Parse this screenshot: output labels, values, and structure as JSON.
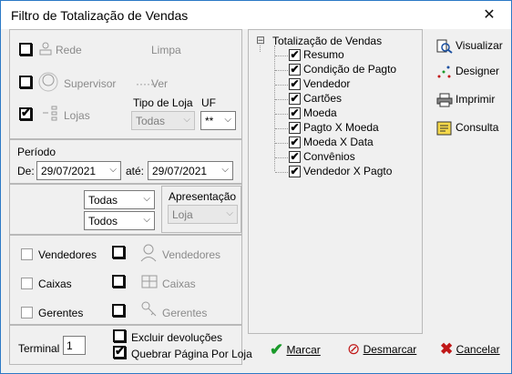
{
  "window": {
    "title": "Filtro de Totalização de Vendas",
    "close_glyph": "✕"
  },
  "left": {
    "rede": {
      "label": "Rede",
      "checked": false
    },
    "limpa": "Limpa",
    "supervisor": {
      "label": "Supervisor",
      "checked": false
    },
    "ver": "Ver",
    "lojas": {
      "label": "Lojas",
      "checked": true
    },
    "tipo_loja_label": "Tipo de Loja",
    "tipo_loja_value": "Todas",
    "uf_label": "UF",
    "uf_value": "**",
    "periodo_label": "Período",
    "de_label": "De:",
    "de_value": "29/07/2021",
    "ate_label": "até:",
    "ate_value": "29/07/2021",
    "select_a_value": "Todas",
    "select_b_value": "Todos",
    "apresentacao_label": "Apresentação",
    "apresentacao_value": "Loja",
    "check_left": [
      {
        "label": "Vendedores",
        "checked": false
      },
      {
        "label": "Caixas",
        "checked": false
      },
      {
        "label": "Gerentes",
        "checked": false
      }
    ],
    "check_right": [
      {
        "label": "Vendedores",
        "checked": false
      },
      {
        "label": "Caixas",
        "checked": false
      },
      {
        "label": "Gerentes",
        "checked": false
      }
    ],
    "terminal_label": "Terminal",
    "terminal_value": "1",
    "excluir_devolucoes": {
      "label": "Excluir devoluções",
      "checked": false
    },
    "quebrar_pagina": {
      "label": "Quebrar Página Por Loja",
      "checked": true
    }
  },
  "tree": {
    "root": "Totalização de Vendas",
    "expander": "⊟",
    "items": [
      {
        "label": "Resumo",
        "checked": true
      },
      {
        "label": "Condição de Pagto",
        "checked": true
      },
      {
        "label": "Vendedor",
        "checked": true
      },
      {
        "label": "Cartões",
        "checked": true
      },
      {
        "label": "Moeda",
        "checked": true
      },
      {
        "label": "Pagto X Moeda",
        "checked": true
      },
      {
        "label": "Moeda X Data",
        "checked": true
      },
      {
        "label": "Convênios",
        "checked": true
      },
      {
        "label": "Vendedor X Pagto",
        "checked": true
      }
    ]
  },
  "right_buttons": [
    {
      "label": "Visualizar",
      "icon": "magnifier-icon"
    },
    {
      "label": "Designer",
      "icon": "designer-icon"
    },
    {
      "label": "Imprimir",
      "icon": "printer-icon"
    },
    {
      "label": "Consulta",
      "icon": "query-icon"
    }
  ],
  "bottom_buttons": {
    "marcar": "Marcar",
    "desmarcar": "Desmarcar",
    "cancelar": "Cancelar"
  },
  "colors": {
    "window_border": "#2b79c6",
    "marcar_green": "#1a9a2a",
    "desmarcar_red": "#c01818",
    "cancelar_red": "#c01818"
  },
  "check_mark": "✔"
}
